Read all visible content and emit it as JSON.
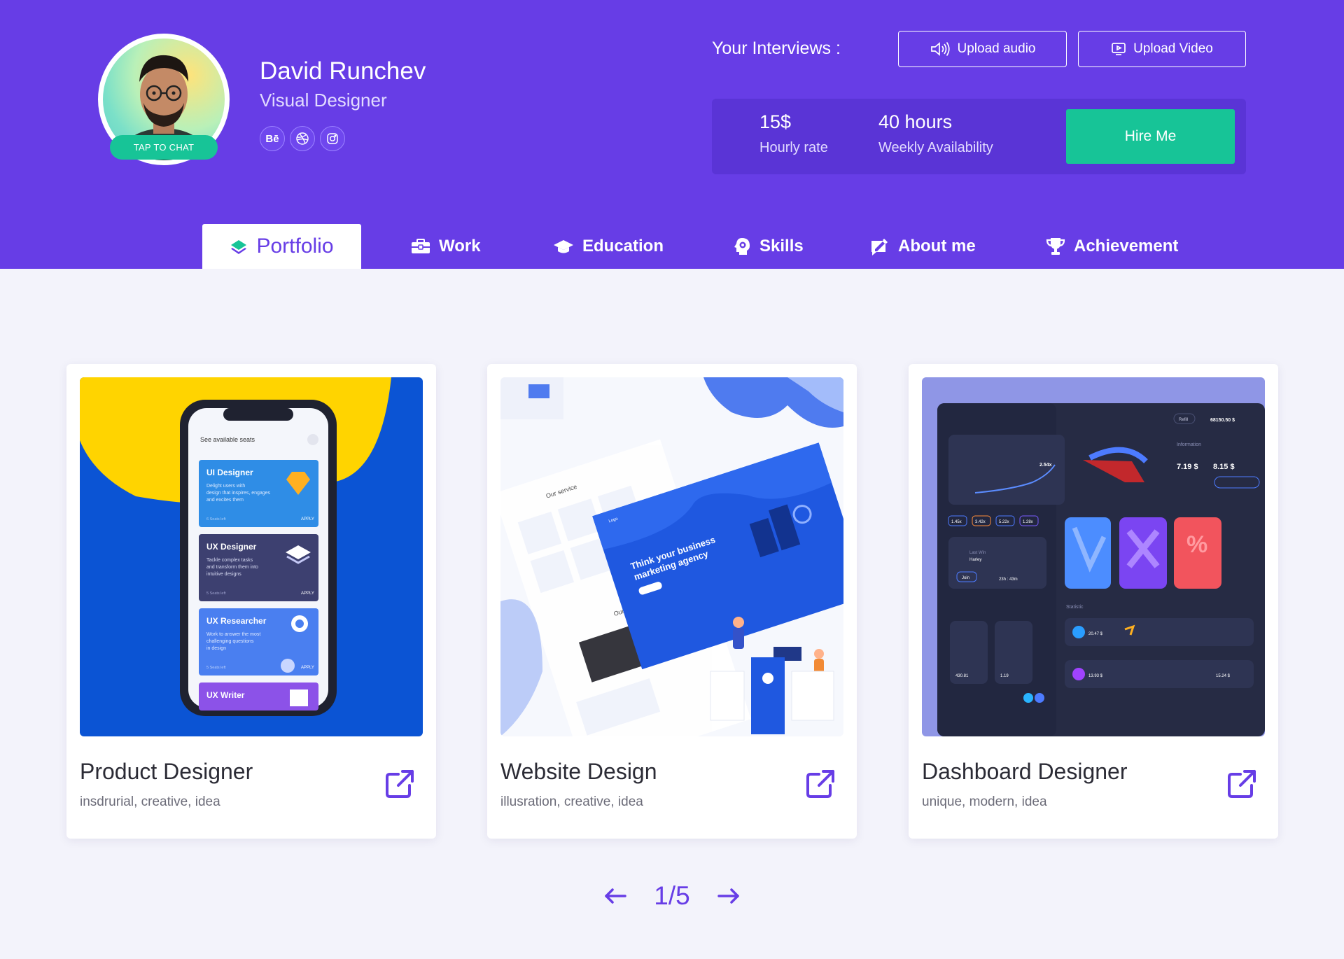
{
  "profile": {
    "name": "David Runchev",
    "role": "Visual Designer",
    "chat_label": "TAP TO CHAT",
    "socials": [
      {
        "icon": "behance-icon",
        "glyph": "Bē"
      },
      {
        "icon": "dribbble-icon",
        "glyph": ""
      },
      {
        "icon": "instagram-icon",
        "glyph": ""
      }
    ]
  },
  "interviews": {
    "label": "Your Interviews :",
    "upload_audio": "Upload audio",
    "upload_video": "Upload Video"
  },
  "stats": {
    "rate_value": "15$",
    "rate_label": "Hourly rate",
    "availability_value": "40 hours",
    "availability_label": "Weekly Availability",
    "hire_label": "Hire Me"
  },
  "tabs": [
    {
      "label": "Portfolio",
      "icon": "layers-icon",
      "active": true
    },
    {
      "label": "Work",
      "icon": "briefcase-icon",
      "active": false
    },
    {
      "label": "Education",
      "icon": "graduation-cap-icon",
      "active": false
    },
    {
      "label": "Skills",
      "icon": "skills-head-icon",
      "active": false
    },
    {
      "label": "About me",
      "icon": "edit-card-icon",
      "active": false
    },
    {
      "label": "Achievement",
      "icon": "trophy-icon",
      "active": false
    }
  ],
  "cards": [
    {
      "title": "Product Designer",
      "tags": "insdrurial, creative, idea"
    },
    {
      "title": "Website Design",
      "tags": "illusration, creative, idea"
    },
    {
      "title": "Dashboard Designer",
      "tags": "unique, modern, idea"
    }
  ],
  "thumbs": {
    "phone": {
      "header": "See available seats",
      "jobs": [
        {
          "title": "UI Designer",
          "desc1": "Delight users with",
          "desc2": "design that inspires, engages",
          "desc3": "and excites them",
          "seats": "6 Seats left",
          "apply": "APPLY"
        },
        {
          "title": "UX Designer",
          "desc1": "Tackle complex tasks",
          "desc2": "and transform them into",
          "desc3": "intuitive designs",
          "seats": "5 Seats left",
          "apply": "APPLY"
        },
        {
          "title": "UX Researcher",
          "desc1": "Work to answer the most",
          "desc2": "challenging questions",
          "desc3": "in design",
          "seats": "5 Seats left",
          "apply": "APPLY"
        },
        {
          "title": "UX Writer",
          "desc1": "",
          "desc2": "",
          "desc3": "",
          "seats": "",
          "apply": ""
        }
      ]
    },
    "website": {
      "headline1": "Think your business",
      "headline2": "marketing agency",
      "our_service": "Our service",
      "our_blog": "Our Blog",
      "logo": "Logo"
    },
    "dashboard": {
      "balance": "68150.50 $",
      "refill": "Refill",
      "chart_value": "2.54x",
      "info_label": "Information",
      "price_from": "7.19 $",
      "price_to": "8.15 $",
      "multipliers": [
        "1.45x",
        "3.42x",
        "5.22x",
        "1.28x"
      ],
      "last_win": "Last Win",
      "user": "Harley",
      "join": "Join",
      "timer": "23h : 43m",
      "statistic": "Statistic",
      "stat_row1_value": "20.47 $",
      "stat_row2_value": "13.93 $",
      "stat_row2_right": "15.24 $",
      "prices_left": [
        "430.81",
        "1.19"
      ]
    }
  },
  "pager": {
    "current": "1/5"
  }
}
